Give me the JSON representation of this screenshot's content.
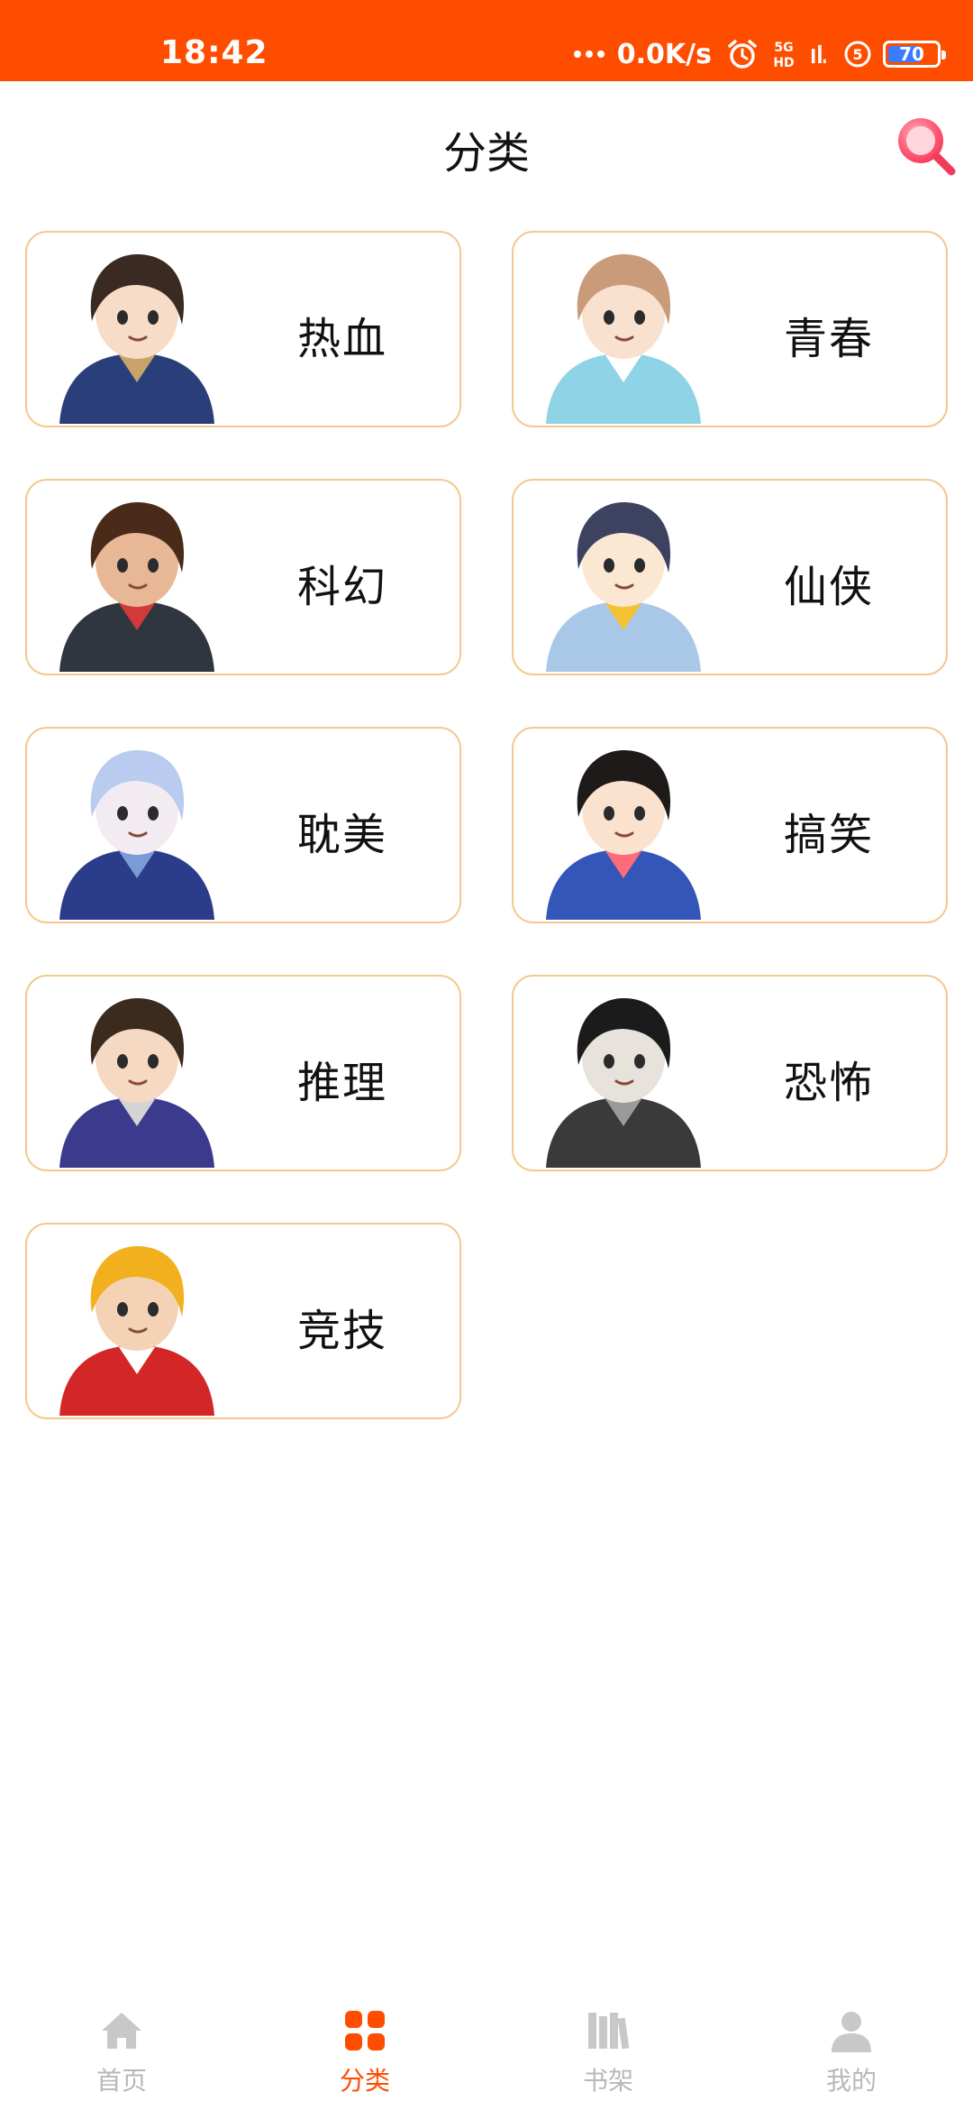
{
  "status_bar": {
    "time": "18:42",
    "net_speed": "0.0K/s",
    "network_badge_top": "5G",
    "network_badge_bottom": "HD",
    "sim_badge": "5",
    "battery_level": "70",
    "battery_fraction": 0.7,
    "icons": [
      "more-dots-icon",
      "alarm-icon",
      "5g-hd-icon",
      "signal-icon",
      "sim-5-icon",
      "battery-icon"
    ]
  },
  "header": {
    "title": "分类",
    "search_icon": "search-icon"
  },
  "categories": [
    {
      "label": "热血",
      "art": "character-art-hot-blooded"
    },
    {
      "label": "青春",
      "art": "character-art-youth"
    },
    {
      "label": "科幻",
      "art": "character-art-sci-fi"
    },
    {
      "label": "仙侠",
      "art": "character-art-xianxia"
    },
    {
      "label": "耽美",
      "art": "character-art-danmei"
    },
    {
      "label": "搞笑",
      "art": "character-art-comedy"
    },
    {
      "label": "推理",
      "art": "character-art-mystery"
    },
    {
      "label": "恐怖",
      "art": "character-art-horror"
    },
    {
      "label": "竞技",
      "art": "character-art-sports"
    }
  ],
  "bottom_nav": {
    "active_index": 1,
    "items": [
      {
        "label": "首页",
        "icon": "home-icon"
      },
      {
        "label": "分类",
        "icon": "category-grid-icon"
      },
      {
        "label": "书架",
        "icon": "bookshelf-icon"
      },
      {
        "label": "我的",
        "icon": "profile-icon"
      }
    ]
  },
  "colors": {
    "brand": "#ff4d00",
    "card_border": "#f3c98f",
    "inactive_nav": "#b8b8b8",
    "battery_fill": "#3b7bff"
  }
}
